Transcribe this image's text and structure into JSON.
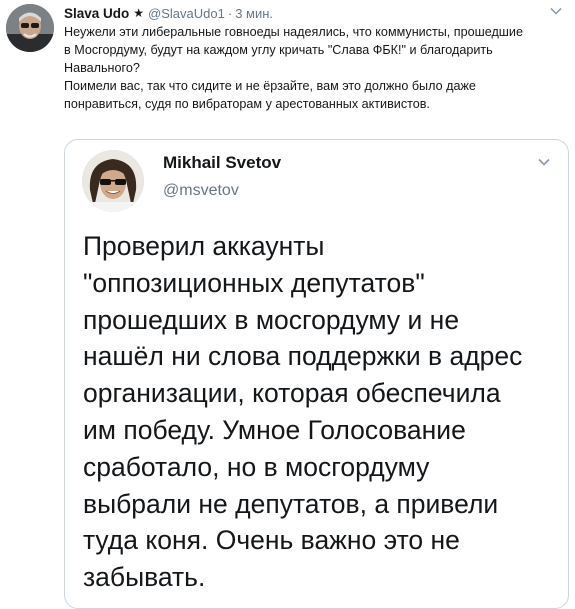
{
  "tweet": {
    "author_name": "Slava Udo",
    "star": "★",
    "handle": "@SlavaUdo1",
    "separator": "·",
    "time": "3 мин.",
    "paragraph1": "Неужели эти либеральные говноеды надеялись, что коммунисты, прошедшие\nв Мосгордуму, будут на каждом углу кричать \"Слава ФБК!\" и благодарить\nНавального?",
    "paragraph2": "Поимели вас, так что сидите и не ёрзайте, вам это должно было даже\nпонравиться, судя по вибраторам у арестованных активистов."
  },
  "quoted_tweet": {
    "author_name": "Mikhail Svetov",
    "handle": "@msvetov",
    "text": "Проверил аккаунты\n\"оппозиционных депутатов\"\nпрошедших в мосгордуму и не\nнашёл ни слова поддержки в адрес\nорганизации, которая обеспечила\nим победу. Умное Голосование\nсработало, но в мосгордуму\nвыбрали не депутатов, а привели\nтуда коня. Очень важно это не\nзабывать."
  },
  "icons": {
    "caret": "chevron-down-icon",
    "avatar": "avatar"
  },
  "colors": {
    "text": "#14171a",
    "secondary": "#657786",
    "border": "#ccd6dd"
  }
}
